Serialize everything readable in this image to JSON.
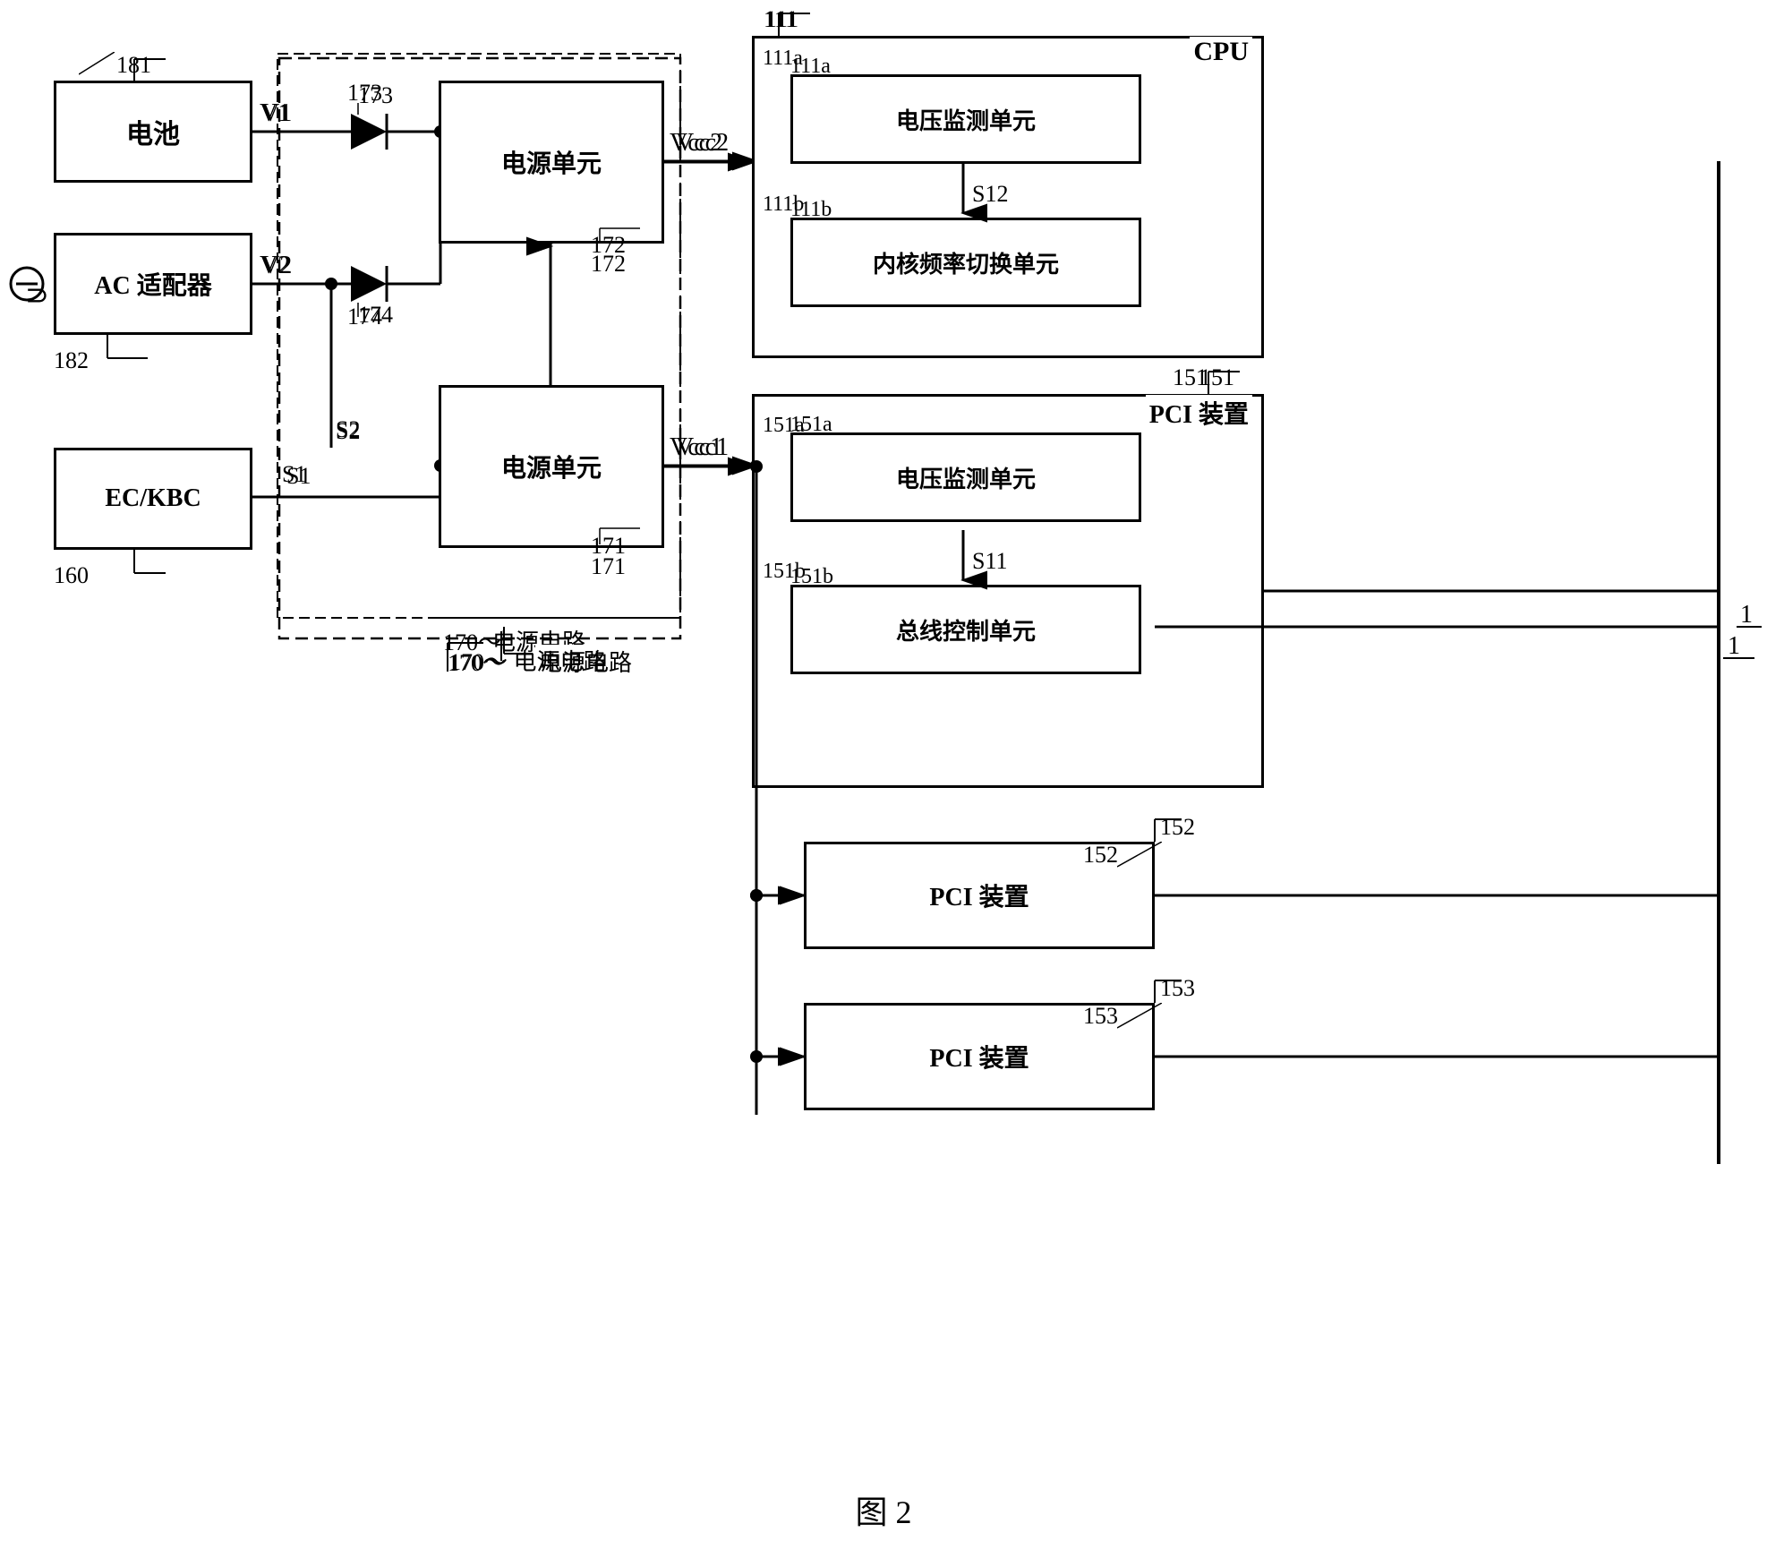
{
  "title": "图2",
  "components": {
    "battery": {
      "label": "电池",
      "ref": "181"
    },
    "ac_adapter": {
      "label": "AC 适配器",
      "ref": "182"
    },
    "ec_kbc": {
      "label": "EC/KBC",
      "ref": "160"
    },
    "power_unit_top": {
      "label": "电源单元",
      "ref": "172"
    },
    "power_unit_bottom": {
      "label": "电源单元",
      "ref": "171"
    },
    "power_circuit": {
      "label": "电源电路",
      "ref": "170"
    },
    "cpu_box": {
      "label": "CPU",
      "ref": "111"
    },
    "voltage_monitor_cpu": {
      "label": "电压监测单元",
      "ref": "111a"
    },
    "core_freq_switch": {
      "label": "内核频率切换单元",
      "ref": "111b"
    },
    "pci_device_main": {
      "label": "PCI 装置",
      "ref": "151"
    },
    "voltage_monitor_pci": {
      "label": "电压监测单元",
      "ref": "151a"
    },
    "bus_control": {
      "label": "总线控制单元",
      "ref": "151b"
    },
    "pci_device_2": {
      "label": "PCI 装置",
      "ref": "152"
    },
    "pci_device_3": {
      "label": "PCI 装置",
      "ref": "153"
    },
    "diode_top": {
      "ref": "173"
    },
    "diode_bottom": {
      "ref": "174"
    },
    "signals": {
      "V1": "V1",
      "V2": "V2",
      "Vcc2": "Vcc2",
      "Vcc1": "Vcc1",
      "S1": "S1",
      "S2": "S2",
      "S11": "S11",
      "S12": "S12"
    },
    "system_ref": "1"
  },
  "caption": "图 2"
}
